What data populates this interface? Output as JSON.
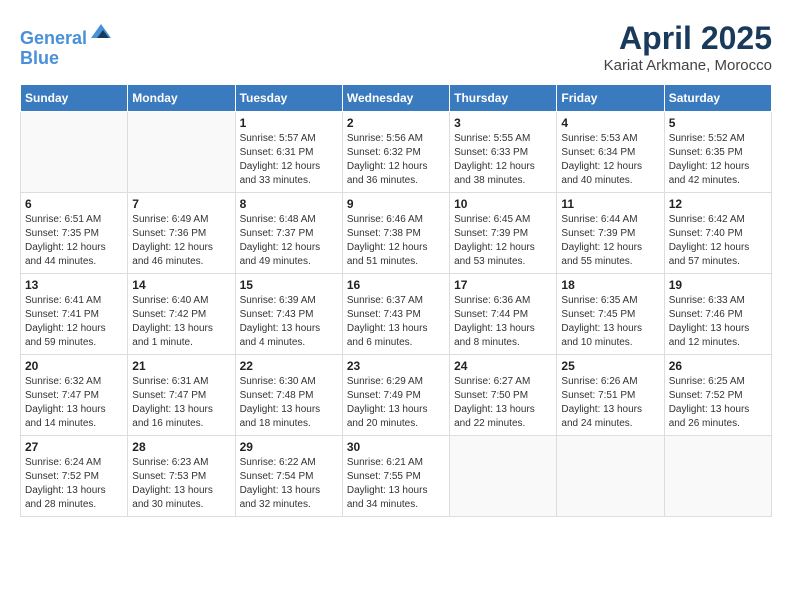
{
  "header": {
    "logo_line1": "General",
    "logo_line2": "Blue",
    "month_title": "April 2025",
    "location": "Kariat Arkmane, Morocco"
  },
  "weekdays": [
    "Sunday",
    "Monday",
    "Tuesday",
    "Wednesday",
    "Thursday",
    "Friday",
    "Saturday"
  ],
  "weeks": [
    [
      {
        "day": "",
        "detail": ""
      },
      {
        "day": "",
        "detail": ""
      },
      {
        "day": "1",
        "detail": "Sunrise: 5:57 AM\nSunset: 6:31 PM\nDaylight: 12 hours and 33 minutes."
      },
      {
        "day": "2",
        "detail": "Sunrise: 5:56 AM\nSunset: 6:32 PM\nDaylight: 12 hours and 36 minutes."
      },
      {
        "day": "3",
        "detail": "Sunrise: 5:55 AM\nSunset: 6:33 PM\nDaylight: 12 hours and 38 minutes."
      },
      {
        "day": "4",
        "detail": "Sunrise: 5:53 AM\nSunset: 6:34 PM\nDaylight: 12 hours and 40 minutes."
      },
      {
        "day": "5",
        "detail": "Sunrise: 5:52 AM\nSunset: 6:35 PM\nDaylight: 12 hours and 42 minutes."
      }
    ],
    [
      {
        "day": "6",
        "detail": "Sunrise: 6:51 AM\nSunset: 7:35 PM\nDaylight: 12 hours and 44 minutes."
      },
      {
        "day": "7",
        "detail": "Sunrise: 6:49 AM\nSunset: 7:36 PM\nDaylight: 12 hours and 46 minutes."
      },
      {
        "day": "8",
        "detail": "Sunrise: 6:48 AM\nSunset: 7:37 PM\nDaylight: 12 hours and 49 minutes."
      },
      {
        "day": "9",
        "detail": "Sunrise: 6:46 AM\nSunset: 7:38 PM\nDaylight: 12 hours and 51 minutes."
      },
      {
        "day": "10",
        "detail": "Sunrise: 6:45 AM\nSunset: 7:39 PM\nDaylight: 12 hours and 53 minutes."
      },
      {
        "day": "11",
        "detail": "Sunrise: 6:44 AM\nSunset: 7:39 PM\nDaylight: 12 hours and 55 minutes."
      },
      {
        "day": "12",
        "detail": "Sunrise: 6:42 AM\nSunset: 7:40 PM\nDaylight: 12 hours and 57 minutes."
      }
    ],
    [
      {
        "day": "13",
        "detail": "Sunrise: 6:41 AM\nSunset: 7:41 PM\nDaylight: 12 hours and 59 minutes."
      },
      {
        "day": "14",
        "detail": "Sunrise: 6:40 AM\nSunset: 7:42 PM\nDaylight: 13 hours and 1 minute."
      },
      {
        "day": "15",
        "detail": "Sunrise: 6:39 AM\nSunset: 7:43 PM\nDaylight: 13 hours and 4 minutes."
      },
      {
        "day": "16",
        "detail": "Sunrise: 6:37 AM\nSunset: 7:43 PM\nDaylight: 13 hours and 6 minutes."
      },
      {
        "day": "17",
        "detail": "Sunrise: 6:36 AM\nSunset: 7:44 PM\nDaylight: 13 hours and 8 minutes."
      },
      {
        "day": "18",
        "detail": "Sunrise: 6:35 AM\nSunset: 7:45 PM\nDaylight: 13 hours and 10 minutes."
      },
      {
        "day": "19",
        "detail": "Sunrise: 6:33 AM\nSunset: 7:46 PM\nDaylight: 13 hours and 12 minutes."
      }
    ],
    [
      {
        "day": "20",
        "detail": "Sunrise: 6:32 AM\nSunset: 7:47 PM\nDaylight: 13 hours and 14 minutes."
      },
      {
        "day": "21",
        "detail": "Sunrise: 6:31 AM\nSunset: 7:47 PM\nDaylight: 13 hours and 16 minutes."
      },
      {
        "day": "22",
        "detail": "Sunrise: 6:30 AM\nSunset: 7:48 PM\nDaylight: 13 hours and 18 minutes."
      },
      {
        "day": "23",
        "detail": "Sunrise: 6:29 AM\nSunset: 7:49 PM\nDaylight: 13 hours and 20 minutes."
      },
      {
        "day": "24",
        "detail": "Sunrise: 6:27 AM\nSunset: 7:50 PM\nDaylight: 13 hours and 22 minutes."
      },
      {
        "day": "25",
        "detail": "Sunrise: 6:26 AM\nSunset: 7:51 PM\nDaylight: 13 hours and 24 minutes."
      },
      {
        "day": "26",
        "detail": "Sunrise: 6:25 AM\nSunset: 7:52 PM\nDaylight: 13 hours and 26 minutes."
      }
    ],
    [
      {
        "day": "27",
        "detail": "Sunrise: 6:24 AM\nSunset: 7:52 PM\nDaylight: 13 hours and 28 minutes."
      },
      {
        "day": "28",
        "detail": "Sunrise: 6:23 AM\nSunset: 7:53 PM\nDaylight: 13 hours and 30 minutes."
      },
      {
        "day": "29",
        "detail": "Sunrise: 6:22 AM\nSunset: 7:54 PM\nDaylight: 13 hours and 32 minutes."
      },
      {
        "day": "30",
        "detail": "Sunrise: 6:21 AM\nSunset: 7:55 PM\nDaylight: 13 hours and 34 minutes."
      },
      {
        "day": "",
        "detail": ""
      },
      {
        "day": "",
        "detail": ""
      },
      {
        "day": "",
        "detail": ""
      }
    ]
  ]
}
